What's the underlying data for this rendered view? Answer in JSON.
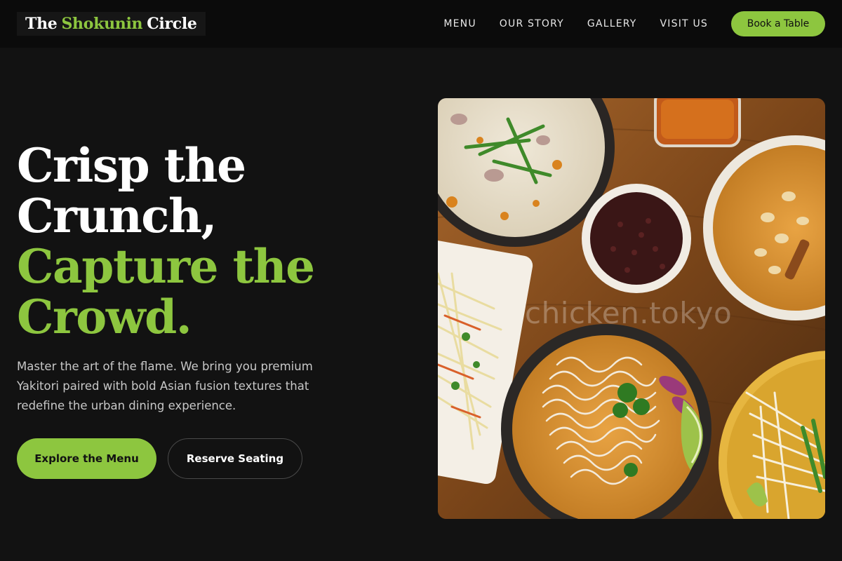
{
  "brand": {
    "prefix": "The",
    "accent": "Shokunin",
    "suffix": "Circle"
  },
  "nav": {
    "links": [
      {
        "label": "MENU"
      },
      {
        "label": "OUR STORY"
      },
      {
        "label": "GALLERY"
      },
      {
        "label": "VISIT US"
      }
    ],
    "cta_label": "Book a Table"
  },
  "hero": {
    "title_lines": [
      "Crisp the",
      "Crunch,",
      "Capture the",
      "Crowd."
    ],
    "description": "Master the art of the flame. We bring you premium Yakitori paired with bold Asian fusion textures that redefine the urban dining experience.",
    "primary_cta": "Explore the Menu",
    "secondary_cta": "Reserve Seating",
    "image_watermark": "chicken.tokyo"
  },
  "colors": {
    "accent": "#8dc63f",
    "background": "#121212",
    "nav_background": "#0b0b0b"
  }
}
